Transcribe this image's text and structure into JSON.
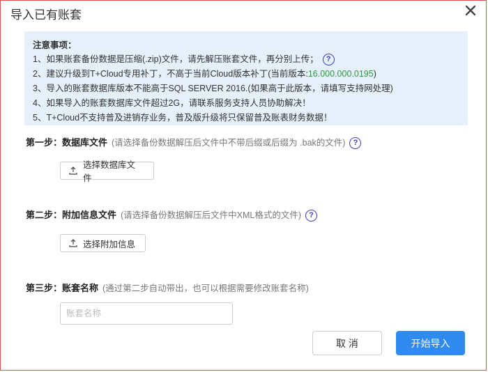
{
  "dialog": {
    "title": "导入已有账套",
    "close_icon": "close-icon"
  },
  "notice": {
    "heading": "注意事项：",
    "line1": "1、如果账套备份数据是压缩(.zip)文件，请先解压账套文件，再分别上传；",
    "line2_prefix": "2、建议升级到T+Cloud专用补丁，不高于当前Cloud版本补丁(当前版本:",
    "line2_version": "16.000.000.0195",
    "line2_suffix": ")",
    "line3": "3、导入的账套数据库版本不能高于SQL SERVER 2016.(如果高于此版本，请填写支持网处理)",
    "line4": "4、如果导入的账套数据库文件超过2G，请联系服务支持人员协助解决！",
    "line5": "5、T+Cloud不支持普及进销存业务，普及版升级将只保留普及账表财务数据！",
    "help_icon": "?"
  },
  "step1": {
    "label": "第一步：数据库文件",
    "hint": "(请选择备份数据解压后文件中不带后缀或后缀为 .bak的文件)",
    "help_icon": "?",
    "button": "选择数据库文件"
  },
  "step2": {
    "label": "第二步：附加信息文件",
    "hint": "(请选择备份数据解压后文件中XML格式的文件)",
    "help_icon": "?",
    "button": "选择附加信息"
  },
  "step3": {
    "label": "第三步：账套名称",
    "hint": "(通过第二步自动带出，也可以根据需要修改账套名称)",
    "placeholder": "账套名称",
    "value": ""
  },
  "footer": {
    "cancel": "取 消",
    "confirm": "开始导入"
  },
  "colors": {
    "primary": "#2f8bf0",
    "notice_bg": "#e6f0fb",
    "version_green": "#2e9a3c",
    "help_blue": "#3b3fc4",
    "frame_red": "#d9534f"
  }
}
